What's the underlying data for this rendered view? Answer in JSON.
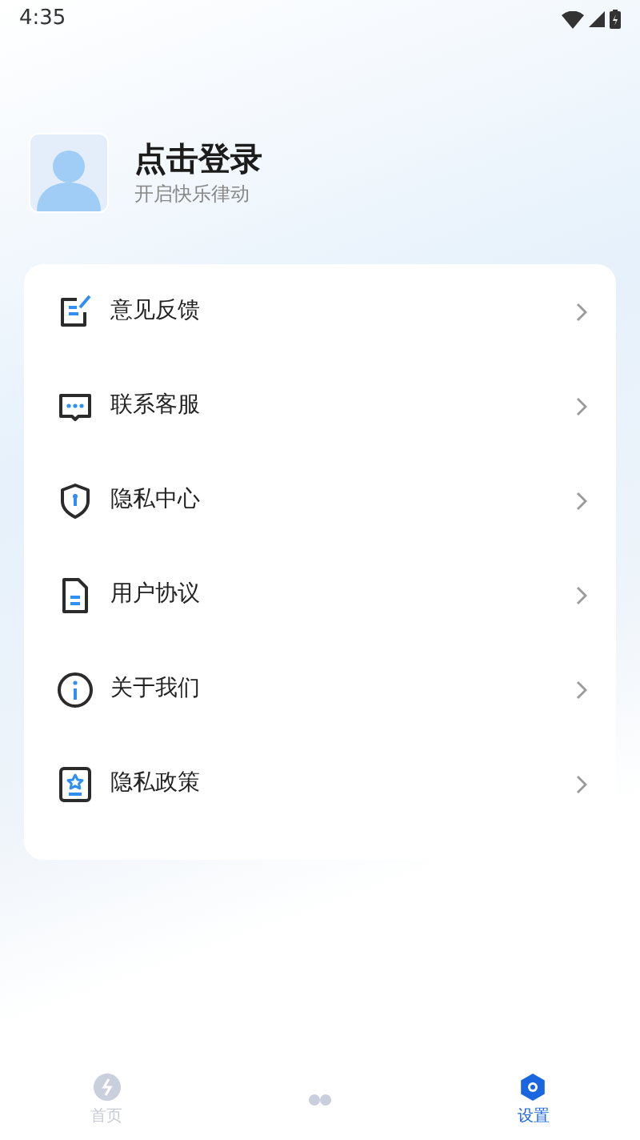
{
  "status_bar": {
    "time": "4:35"
  },
  "profile": {
    "title": "点击登录",
    "subtitle": "开启快乐律动"
  },
  "menu": [
    {
      "label": "意见反馈",
      "kind": "feedback"
    },
    {
      "label": "联系客服",
      "kind": "chat"
    },
    {
      "label": "隐私中心",
      "kind": "shield"
    },
    {
      "label": "用户协议",
      "kind": "document"
    },
    {
      "label": "关于我们",
      "kind": "info"
    },
    {
      "label": "隐私政策",
      "kind": "policy"
    }
  ],
  "bottom_nav": [
    {
      "label": "首页",
      "kind": "home",
      "selected": false
    },
    {
      "kind": "music",
      "selected": false
    },
    {
      "label": "设置",
      "kind": "settings",
      "selected": true
    }
  ]
}
